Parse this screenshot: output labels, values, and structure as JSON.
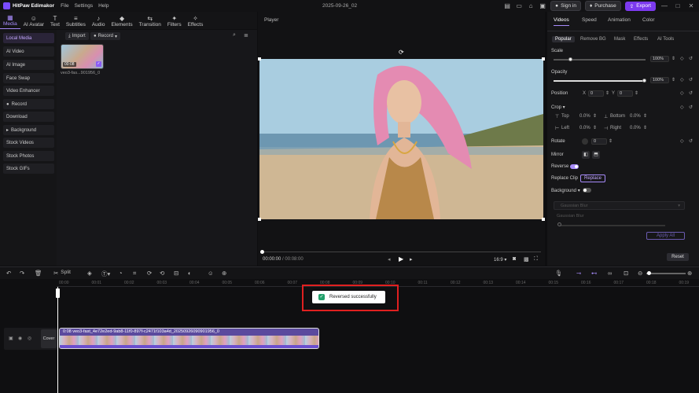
{
  "app": {
    "name": "HitPaw Edimakor",
    "menus": [
      "File",
      "Settings",
      "Help"
    ],
    "project_title": "2025-09-26_02"
  },
  "header_buttons": {
    "signin": "Sign in",
    "purchase": "Purchase",
    "export": "Export"
  },
  "toolbar": [
    "Media",
    "AI Avatar",
    "Text",
    "Subtitles",
    "Audio",
    "Elements",
    "Transition",
    "Filters",
    "Effects"
  ],
  "sidebar": [
    "Local Media",
    "AI Video",
    "AI Image",
    "Face Swap",
    "Video Enhancer",
    "Record",
    "Download",
    "Background",
    "Stock Videos",
    "Stock Photos",
    "Stock GIFs"
  ],
  "media": {
    "import": "Import",
    "record": "Record",
    "thumb_duration": "00:08",
    "thumb_name": "veo3-fas...901956_0"
  },
  "player": {
    "title": "Player",
    "current_time": "00:00:00",
    "total_time": "/ 00:08:00",
    "aspect": "16:9"
  },
  "props": {
    "tabs": [
      "Videos",
      "Speed",
      "Animation",
      "Color"
    ],
    "subtabs": [
      "Popular",
      "Remove BG",
      "Mask",
      "Effects",
      "AI Tools"
    ],
    "scale_label": "Scale",
    "scale_value": "100%",
    "opacity_label": "Opacity",
    "opacity_value": "100%",
    "position_label": "Position",
    "pos_x_label": "X",
    "pos_x": "0",
    "pos_y_label": "Y",
    "pos_y": "0",
    "crop_label": "Crop",
    "crop_top_label": "Top",
    "crop_top": "0.0%",
    "crop_bottom_label": "Bottom",
    "crop_bottom": "0.0%",
    "crop_left_label": "Left",
    "crop_left": "0.0%",
    "crop_right_label": "Right",
    "crop_right": "0.0%",
    "rotate_label": "Rotate",
    "rotate_value": "0",
    "mirror_label": "Mirror",
    "reverse_label": "Reverse",
    "replace_clip_label": "Replace Clip",
    "replace_button": "Replace",
    "background_label": "Background",
    "bg_select": "Gaussian Blur",
    "gaussian_label": "Gaussian Blur",
    "apply_all": "Apply All",
    "reset": "Reset"
  },
  "timeline": {
    "split": "Split",
    "ticks": [
      "00:00",
      "00:01",
      "00:02",
      "00:03",
      "00:04",
      "00:05",
      "00:06",
      "00:07",
      "00:08",
      "00:09",
      "00:10",
      "00:11",
      "00:12",
      "00:13",
      "00:14",
      "00:15",
      "00:16",
      "00:17",
      "00:18",
      "00:19"
    ],
    "cover": "Cover",
    "clip_label": "0:08  veo3-fast_4e72e2ed-9ab8-11f0-897f-c2471f103a4d_20250926090901956_0"
  },
  "toast": {
    "message": "Reversed successfully"
  },
  "colors": {
    "accent": "#7c3aed",
    "toast_border": "#e02020",
    "success": "#22a06b"
  }
}
